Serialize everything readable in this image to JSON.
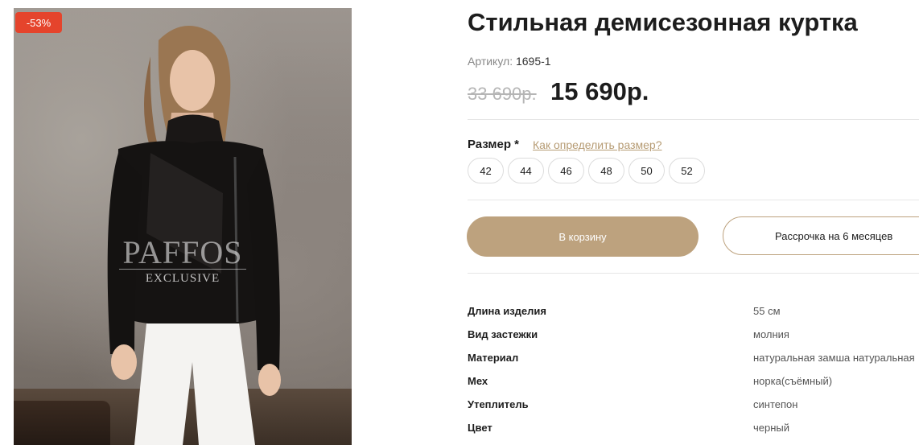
{
  "product": {
    "discount_badge": "-53%",
    "title": "Стильная демисезонная куртка",
    "sku_label": "Артикул:",
    "sku_value": "1695-1",
    "old_price": "33 690р.",
    "new_price": "15 690р.",
    "watermark_brand": "PAFFOS",
    "watermark_sub": "EXCLUSIVE"
  },
  "size": {
    "label": "Размер *",
    "link": "Как определить размер?",
    "options": [
      "42",
      "44",
      "46",
      "48",
      "50",
      "52"
    ]
  },
  "actions": {
    "cart": "В корзину",
    "credit": "Рассрочка на 6 месяцев"
  },
  "specs": [
    {
      "key": "Длина изделия",
      "value": "55 см"
    },
    {
      "key": "Вид застежки",
      "value": "молния"
    },
    {
      "key": "Материал",
      "value": "натуральная замша натуральная"
    },
    {
      "key": "Мех",
      "value": "норка(съёмный)"
    },
    {
      "key": "Утеплитель",
      "value": "синтепон"
    },
    {
      "key": "Цвет",
      "value": "черный"
    }
  ],
  "colors": {
    "accent": "#bda27e",
    "badge": "#e5442c"
  }
}
